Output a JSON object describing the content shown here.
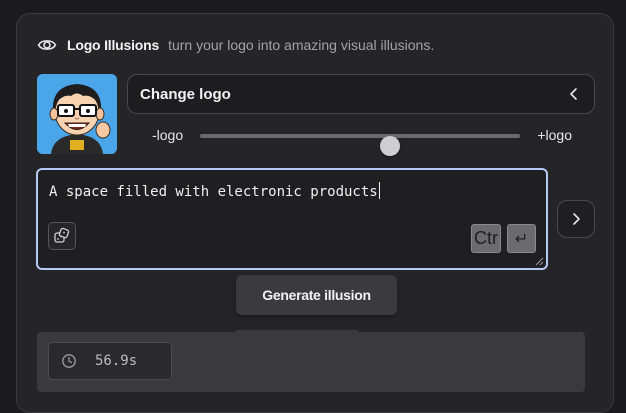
{
  "header": {
    "icon": "eye-icon",
    "title": "Logo Illusions",
    "subtitle": "turn your logo into amazing visual illusions."
  },
  "logo": {
    "icon": "cartoon-avatar-logo",
    "change_label": "Change logo",
    "change_icon": "chevron-left-icon"
  },
  "strength": {
    "min_label": "-logo",
    "max_label": "+logo",
    "value": 0.595
  },
  "prompt": {
    "value": "A space filled with electronic products",
    "dice_icon": "dice-icon",
    "ctrl_key": "Ctr",
    "enter_key": "↵"
  },
  "side_button": {
    "icon": "chevron-right-icon"
  },
  "generate": {
    "label": "Generate illusion"
  },
  "timer": {
    "icon": "clock-icon",
    "value": "56.9s"
  },
  "colors": {
    "panel": "#252527",
    "focus_border": "#b8c8f6",
    "logo_background": "#4aa6e8"
  }
}
